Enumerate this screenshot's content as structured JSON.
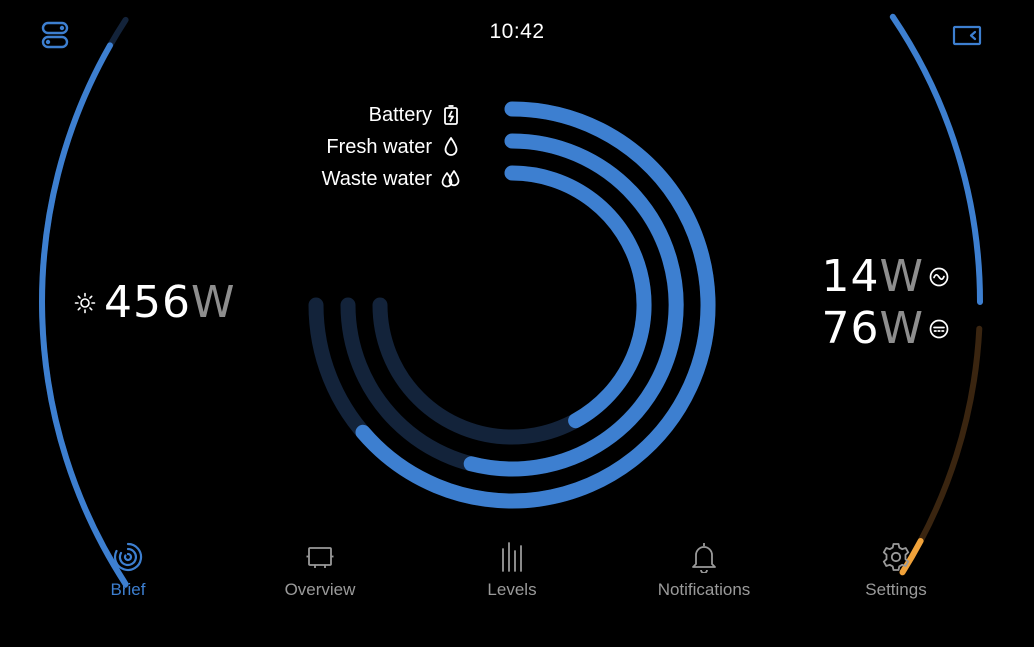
{
  "status_bar": {
    "time": "10:42"
  },
  "tanks": [
    {
      "label": "Battery",
      "icon": "battery-charging-icon",
      "level": 0.85
    },
    {
      "label": "Fresh water",
      "icon": "water-drop-icon",
      "level": 0.72
    },
    {
      "label": "Waste water",
      "icon": "waste-water-drops-icon",
      "level": 0.56
    }
  ],
  "solar": {
    "icon": "sun-icon",
    "value": "456",
    "unit": "W",
    "level": 0.95
  },
  "loads": {
    "ac": {
      "value": "14",
      "unit": "W",
      "icon": "ac-wave-icon",
      "level": 0.45
    },
    "dc": {
      "value": "76",
      "unit": "W",
      "icon": "dc-icon",
      "level": 0.14
    }
  },
  "colors": {
    "accent": "#3d7fd0",
    "track": "#13233a",
    "dc_track": "#3a2510",
    "dc_fill": "#f0a23a",
    "muted": "#9a9a9a"
  },
  "nav": {
    "active": "brief",
    "items": [
      {
        "key": "brief",
        "label": "Brief",
        "icon": "brief-rings-icon"
      },
      {
        "key": "overview",
        "label": "Overview",
        "icon": "overview-screen-icon"
      },
      {
        "key": "levels",
        "label": "Levels",
        "icon": "levels-bars-icon"
      },
      {
        "key": "notifications",
        "label": "Notifications",
        "icon": "bell-icon"
      },
      {
        "key": "settings",
        "label": "Settings",
        "icon": "gear-icon"
      }
    ]
  }
}
